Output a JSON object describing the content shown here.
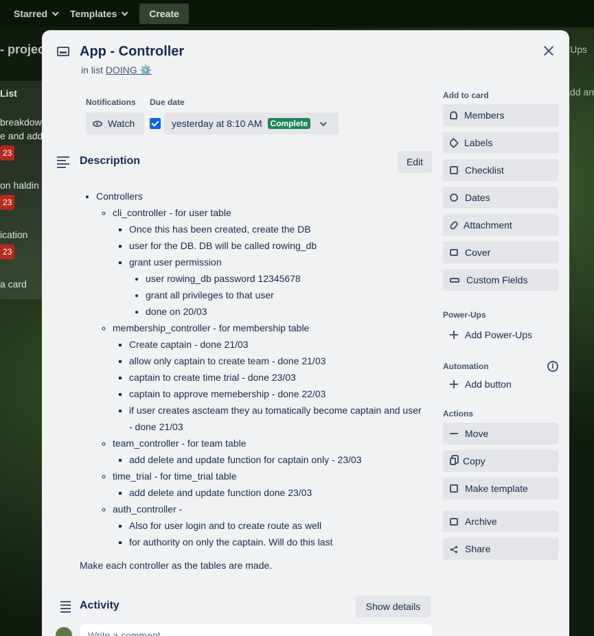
{
  "topbar": {
    "starred": "Starred",
    "templates": "Templates",
    "create": "Create"
  },
  "board": {
    "title_fragment": "- projec",
    "right_fragment": "Ups",
    "right_fragment2": "Add an",
    "list_header": "List",
    "cards": [
      {
        "line1": "breakdow",
        "line2": "e and add",
        "badge": "23"
      },
      {
        "line1": "on haldin",
        "badge": "23"
      },
      {
        "line1": "ication",
        "badge": "23"
      }
    ],
    "add_card": "a card"
  },
  "card": {
    "title": "App - Controller",
    "in_list_prefix": "in list",
    "list_name": "DOING ⚙️",
    "notifications_label": "Notifications",
    "watch_label": "Watch",
    "due_label": "Due date",
    "due_value": "yesterday at 8:10 AM",
    "due_status": "Complete",
    "description_title": "Description",
    "edit_label": "Edit",
    "description": {
      "root": "Controllers",
      "cli": "cli_controller - for user table",
      "cli_items": [
        "Once this has been created, create the DB",
        "user for the DB. DB will be called rowing_db",
        "grant user permission"
      ],
      "grant_items": [
        "user rowing_db password 12345678",
        "grant all privileges to that user",
        "done on 20/03"
      ],
      "membership": "membership_controller - for membership table",
      "membership_items": [
        "Create captain - done 21/03",
        "allow only captain to create team - done 21/03",
        "captain to create time trial - done 23/03",
        "captain to approve memebership - done 22/03",
        "if user creates ascteam they au tomatically become captain and user - done 21/03"
      ],
      "team": "team_controller - for team table",
      "team_items": [
        "add delete and update function for captain only - 23/03"
      ],
      "time_trial": "time_trial - for time_trial table",
      "time_trial_items": [
        "add delete and update function done 23/03"
      ],
      "auth": "auth_controller -",
      "auth_items": [
        "Also for user login and to create route as well",
        "for authority on only the captain. Will do this last"
      ],
      "footer": "Make each controller as the tables are made."
    },
    "activity_title": "Activity",
    "show_details": "Show details",
    "comment_placeholder": "Write a comment..."
  },
  "sidebar": {
    "add_to_card": "Add to card",
    "add_items": [
      {
        "label": "Members",
        "icon": "person-icon"
      },
      {
        "label": "Labels",
        "icon": "tag-icon"
      },
      {
        "label": "Checklist",
        "icon": "checklist-icon"
      },
      {
        "label": "Dates",
        "icon": "clock-icon"
      },
      {
        "label": "Attachment",
        "icon": "paperclip-icon"
      },
      {
        "label": "Cover",
        "icon": "cover-icon"
      },
      {
        "label": "Custom Fields",
        "icon": "fields-icon"
      }
    ],
    "power_ups": "Power-Ups",
    "add_power_ups": "Add Power-Ups",
    "automation": "Automation",
    "add_button": "Add button",
    "actions": "Actions",
    "action_items": [
      {
        "label": "Move",
        "icon": "arrow-right-icon"
      },
      {
        "label": "Copy",
        "icon": "copy-icon"
      },
      {
        "label": "Make template",
        "icon": "template-icon"
      }
    ],
    "archive": "Archive",
    "share": "Share"
  },
  "colors": {
    "modal_bg": "#f1f2f4",
    "button_bg": "#e3e5e8",
    "complete_green": "#1f845a",
    "checkbox_blue": "#0c66e4",
    "badge_red": "#b32a1f"
  }
}
